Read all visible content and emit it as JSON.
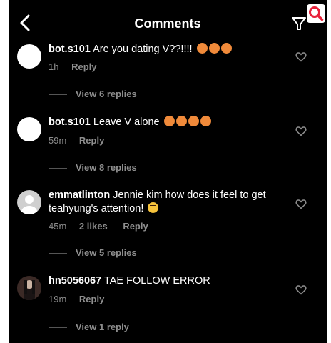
{
  "header": {
    "title": "Comments"
  },
  "comments": [
    {
      "user": "bot.s101",
      "text": "Are you dating V??!!!!",
      "time": "1h",
      "likes": "",
      "reply": "Reply",
      "view_replies": "View 6 replies",
      "emoji": "angry-face"
    },
    {
      "user": "bot.s101",
      "text": "Leave V alone",
      "time": "59m",
      "likes": "",
      "reply": "Reply",
      "view_replies": "View 8 replies",
      "emoji": "angry-face"
    },
    {
      "user": "emmatlinton",
      "text": "Jennie kim how does it feel to get teahyung's attention!",
      "time": "45m",
      "likes": "2 likes",
      "reply": "Reply",
      "view_replies": "View 5 replies",
      "emoji": "cold-sweat-face"
    },
    {
      "user": "hn5056067",
      "text": "TAE FOLLOW ERROR",
      "time": "19m",
      "likes": "",
      "reply": "Reply",
      "view_replies": "View 1 reply",
      "emoji": ""
    }
  ],
  "colors": {
    "background": "#000000",
    "text": "#ffffff",
    "meta": "#8e8e8e",
    "accent_search": "#e8213a"
  },
  "icons": [
    "back-chevron-icon",
    "filter-icon",
    "search-icon",
    "heart-icon"
  ]
}
